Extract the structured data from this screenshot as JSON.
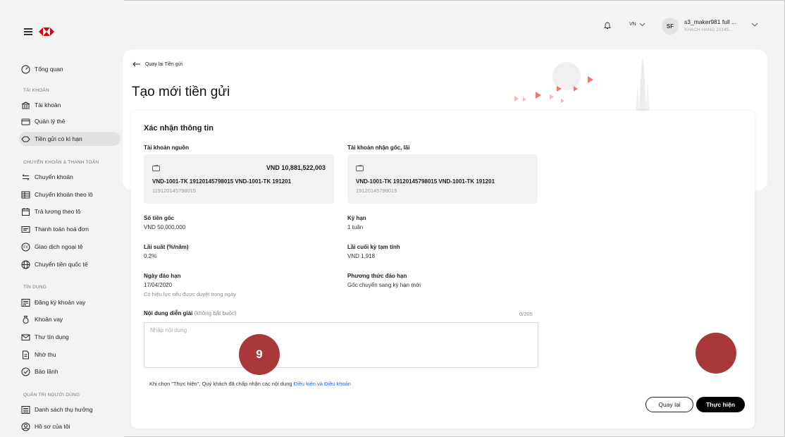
{
  "header": {
    "lang": "VN",
    "avatar_initials": "SF",
    "user_name": "s3_maker981 full ...",
    "user_sub": "KHACH HANG 20145...",
    "brand_color": "#db0011"
  },
  "sidebar": {
    "overview": "Tổng quan",
    "sections": {
      "account": "TÀI KHOẢN",
      "transfer": "CHUYỂN KHOẢN & THANH TOÁN",
      "credit": "TÍN DỤNG",
      "admin": "QUẢN TRỊ NGƯỜI DÙNG"
    },
    "items": {
      "accounts": "Tài khoản",
      "cards": "Quản lý thẻ",
      "deposits": "Tiền gửi có kì hạn",
      "transfer": "Chuyển khoản",
      "batch_transfer": "Chuyển khoản theo lô",
      "payroll": "Trả lương theo lô",
      "bill_pay": "Thanh toán hoá đơn",
      "fx": "Giao dịch ngoại tệ",
      "intl_transfer": "Chuyển tiền quốc tế",
      "loan_register": "Đăng ký khoản vay",
      "loans": "Khoản vay",
      "letter_credit": "Thư tín dụng",
      "collection": "Nhờ thu",
      "guarantee": "Bảo lãnh",
      "beneficiaries": "Danh sách thụ hưởng",
      "profile": "Hồ sơ của tôi"
    }
  },
  "banner": {
    "back_label": "Quay lại Tiền gửi",
    "title": "Tạo mới tiền gửi"
  },
  "form": {
    "title": "Xác nhận thông tin",
    "source_label": "Tài khoản nguồn",
    "source_amount": "VND  10,881,522,003",
    "source_name": "VND-1001-TK 19120145798015 VND-1001-TK 191201",
    "source_number": "119120145798015",
    "receive_label": "Tài khoản nhận gốc, lãi",
    "receive_name": "VND-1001-TK 19120145798015 VND-1001-TK 191201",
    "receive_number": "19120145798015",
    "principal_label": "Số tiền gốc",
    "principal_value": "VND 50,000,000",
    "term_label": "Kỳ hạn",
    "term_value": "1 tuần",
    "rate_label": "Lãi suất (%/năm)",
    "rate_value": "0.2%",
    "interest_label": "Lãi cuối kỳ tạm tính",
    "interest_value": "VND 1,918",
    "maturity_label": "Ngày đáo hạn",
    "maturity_value": "17/04/2020",
    "maturity_note": "Có hiệu lực nếu được duyệt trong ngày",
    "method_label": "Phương thức đáo hạn",
    "method_value": "Gốc chuyển sang kỳ hạn mới",
    "desc_label": "Nội dung diễn giải",
    "desc_optional": "(không bắt buộc)",
    "desc_counter": "0/205",
    "desc_placeholder": "Nhập nội dung",
    "terms_prefix": "Khi chọn \"Thực hiện\", Quý khách đã chấp nhận các nội dung",
    "terms_link": "Điều kiện và Điều khoản",
    "back_button": "Quay lại",
    "submit_button": "Thực hiện"
  },
  "overlay": {
    "step_number": "9",
    "marker_color": "#a8383a"
  }
}
